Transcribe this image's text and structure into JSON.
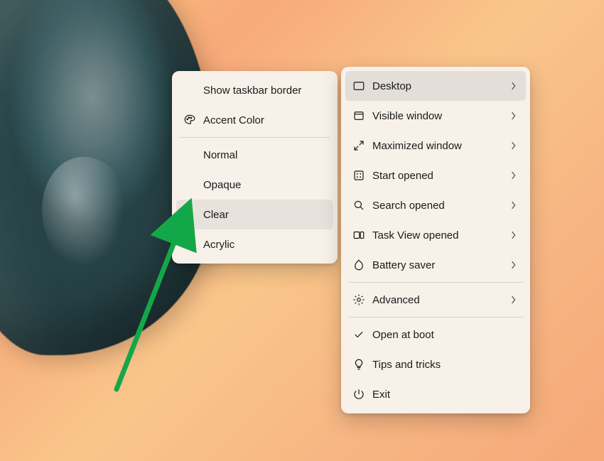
{
  "leftMenu": {
    "items": [
      {
        "label": "Show taskbar border"
      },
      {
        "label": "Accent Color"
      },
      {
        "label": "Normal"
      },
      {
        "label": "Opaque"
      },
      {
        "label": "Clear"
      },
      {
        "label": "Acrylic"
      }
    ],
    "selectedIndex": 4
  },
  "rightMenu": {
    "items": [
      {
        "label": "Desktop"
      },
      {
        "label": "Visible window"
      },
      {
        "label": "Maximized window"
      },
      {
        "label": "Start opened"
      },
      {
        "label": "Search opened"
      },
      {
        "label": "Task View opened"
      },
      {
        "label": "Battery saver"
      },
      {
        "label": "Advanced"
      },
      {
        "label": "Open at boot"
      },
      {
        "label": "Tips and tricks"
      },
      {
        "label": "Exit"
      }
    ],
    "highlightedIndex": 0
  },
  "annotationArrowColor": "#14a74a"
}
